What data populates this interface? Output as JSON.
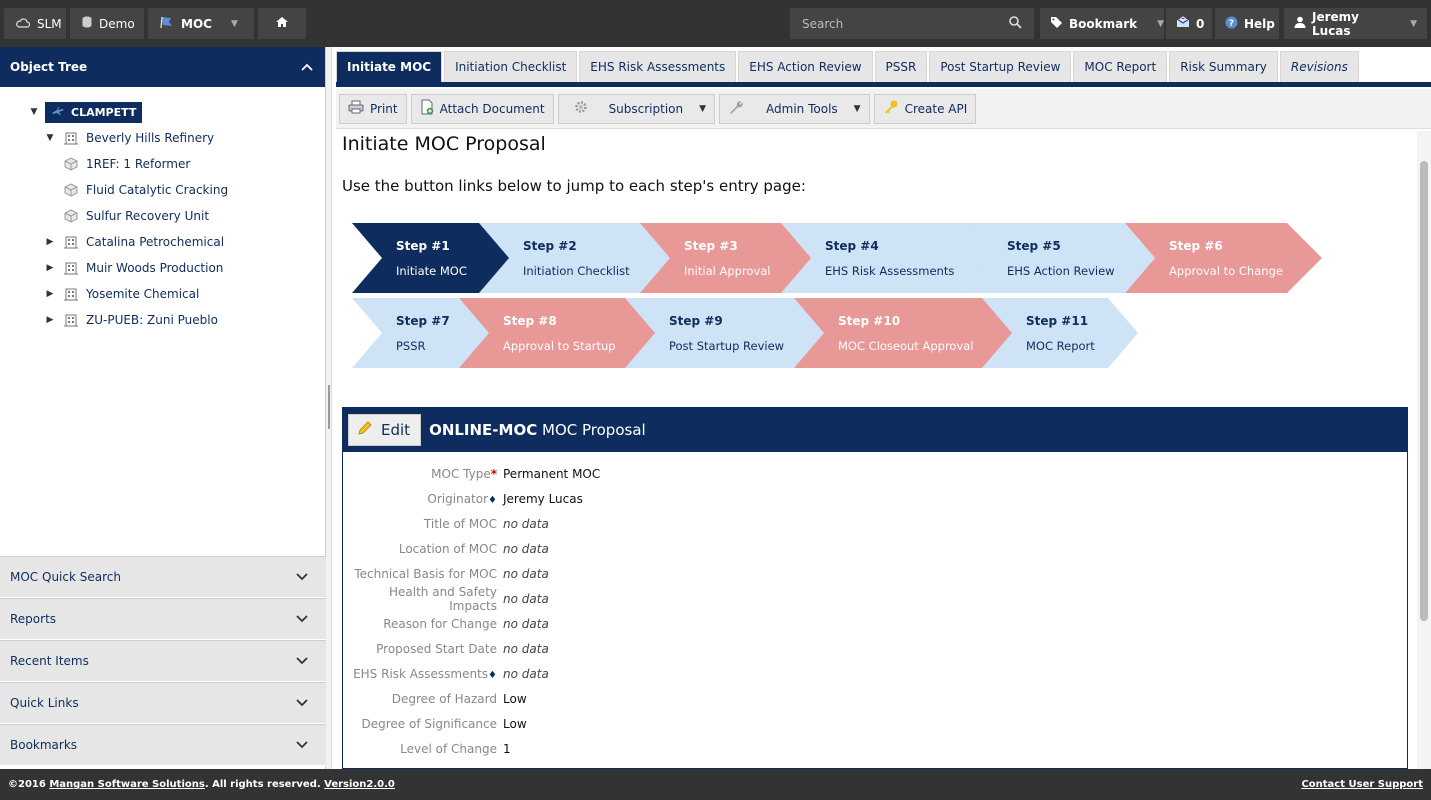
{
  "topbar": {
    "slm": "SLM",
    "demo": "Demo",
    "moc": "MOC",
    "search_placeholder": "Search",
    "bookmark": "Bookmark",
    "inbox_count": "0",
    "help": "Help",
    "user": "Jeremy Lucas"
  },
  "sidebar": {
    "tree_title": "Object Tree",
    "root": "CLAMPETT",
    "nodes": [
      "Beverly Hills Refinery",
      "1REF: 1 Reformer",
      "Fluid Catalytic Cracking",
      "Sulfur Recovery Unit",
      "Catalina Petrochemical",
      "Muir Woods Production",
      "Yosemite Chemical",
      "ZU-PUEB: Zuni Pueblo"
    ],
    "accordion": [
      "MOC Quick Search",
      "Reports",
      "Recent Items",
      "Quick Links",
      "Bookmarks"
    ]
  },
  "tabs": [
    "Initiate MOC",
    "Initiation Checklist",
    "EHS Risk Assessments",
    "EHS Action Review",
    "PSSR",
    "Post Startup Review",
    "MOC Report",
    "Risk Summary",
    "Revisions"
  ],
  "toolbar": {
    "print": "Print",
    "attach": "Attach Document",
    "subscription": "Subscription",
    "admin": "Admin Tools",
    "api": "Create API"
  },
  "page": {
    "title": "Initiate MOC Proposal",
    "intro": "Use the button links below to jump to each step's entry page:"
  },
  "steps": [
    {
      "num": "Step #1",
      "label": "Initiate MOC"
    },
    {
      "num": "Step #2",
      "label": "Initiation Checklist"
    },
    {
      "num": "Step #3",
      "label": "Initial Approval"
    },
    {
      "num": "Step #4",
      "label": "EHS Risk Assessments"
    },
    {
      "num": "Step #5",
      "label": "EHS Action Review"
    },
    {
      "num": "Step #6",
      "label": "Approval to Change"
    },
    {
      "num": "Step #7",
      "label": "PSSR"
    },
    {
      "num": "Step #8",
      "label": "Approval to Startup"
    },
    {
      "num": "Step #9",
      "label": "Post Startup Review"
    },
    {
      "num": "Step #10",
      "label": "MOC Closeout Approval"
    },
    {
      "num": "Step #11",
      "label": "MOC Report"
    }
  ],
  "colors": {
    "navy": "#0e2d5e",
    "step_active": "#0e2d5e",
    "step_blue": "#cfe3f6",
    "step_red": "#e99898"
  },
  "panel": {
    "edit": "Edit",
    "title_bold": "ONLINE-MOC",
    "title_rest": "MOC Proposal",
    "fields": [
      {
        "label": "MOC Type",
        "value": "Permanent MOC"
      },
      {
        "label": "Originator",
        "value": "Jeremy Lucas"
      },
      {
        "label": "Title of MOC",
        "value": "no data"
      },
      {
        "label": "Location of MOC",
        "value": "no data"
      },
      {
        "label": "Technical Basis for MOC",
        "value": "no data"
      },
      {
        "label": "Health and Safety Impacts",
        "value": "no data"
      },
      {
        "label": "Reason for Change",
        "value": "no data"
      },
      {
        "label": "Proposed Start Date",
        "value": "no data"
      },
      {
        "label": "EHS Risk Assessments",
        "value": "no data"
      },
      {
        "label": "Degree of Hazard",
        "value": "Low"
      },
      {
        "label": "Degree of Significance",
        "value": "Low"
      },
      {
        "label": "Level of Change",
        "value": "1"
      }
    ]
  },
  "footer": {
    "prefix": "©2016 ",
    "company": "Mangan Software Solutions",
    "middle": ". All rights reserved. ",
    "version": "Version2.0.0",
    "support": "Contact User Support"
  }
}
